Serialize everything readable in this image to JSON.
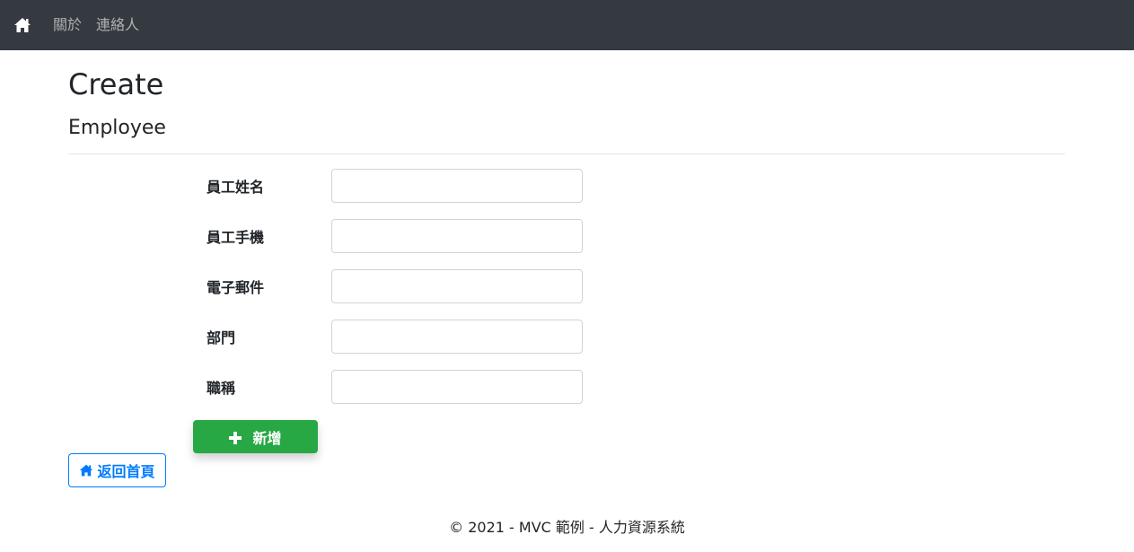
{
  "navbar": {
    "home_icon": "home-icon",
    "links": [
      {
        "label": "關於"
      },
      {
        "label": "連絡人"
      }
    ],
    "background": "#343a40"
  },
  "main": {
    "page_title": "Create",
    "section_title": "Employee",
    "form": {
      "fields": [
        {
          "label": "員工姓名",
          "value": "",
          "placeholder": ""
        },
        {
          "label": "員工手機",
          "value": "",
          "placeholder": ""
        },
        {
          "label": "電子郵件",
          "value": "",
          "placeholder": ""
        },
        {
          "label": "部門",
          "value": "",
          "placeholder": ""
        },
        {
          "label": "職稱",
          "value": "",
          "placeholder": ""
        }
      ],
      "submit_label": "新增",
      "submit_icon": "plus-icon",
      "submit_color": "#28a745"
    },
    "back_button": {
      "label": "返回首頁",
      "icon": "home-icon",
      "color": "#007bff"
    }
  },
  "footer": {
    "text": "© 2021 - MVC 範例 - 人力資源系統"
  }
}
